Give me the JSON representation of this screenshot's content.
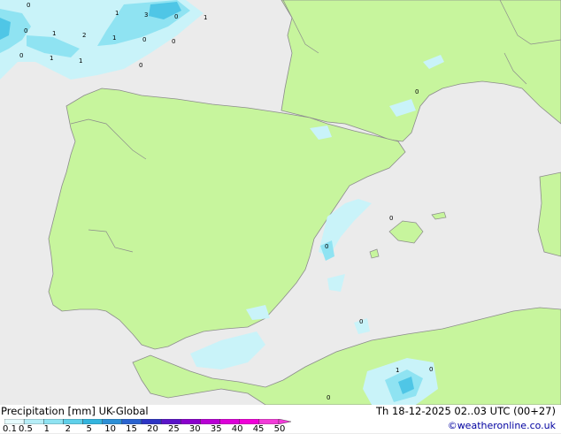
{
  "map": {
    "colors": {
      "sea": "#ebebeb",
      "land": "#c7f59d",
      "coast": "#8c8c8c",
      "precip_light": "#c9f3f9",
      "precip_mid": "#8fe3f2",
      "precip_heavy": "#4fc6e6"
    },
    "cell_labels": [
      "0",
      "1",
      "3",
      "0",
      "1",
      "0",
      "1",
      "2",
      "1",
      "0",
      "0",
      "0",
      "1",
      "1",
      "0",
      "0",
      "0",
      "0",
      "0",
      "1",
      "0",
      "0"
    ]
  },
  "footer": {
    "title_left": "Precipitation [mm]  UK-Global",
    "title_right": "Th 18-12-2025 02..03 UTC (00+27)",
    "credit": "©weatheronline.co.uk",
    "legend": {
      "ticks": [
        "0.1",
        "0.5",
        "1",
        "2",
        "5",
        "10",
        "15",
        "20",
        "25",
        "30",
        "35",
        "40",
        "45",
        "50"
      ],
      "colors": [
        "#e6fbfd",
        "#b6eef7",
        "#8fe3f2",
        "#5fd0ea",
        "#33b4de",
        "#2d8fd6",
        "#2a63cf",
        "#2d34c4",
        "#5a14c8",
        "#8a00cc",
        "#b800d4",
        "#dc00d8",
        "#f000d8",
        "#f23cd8"
      ]
    }
  }
}
